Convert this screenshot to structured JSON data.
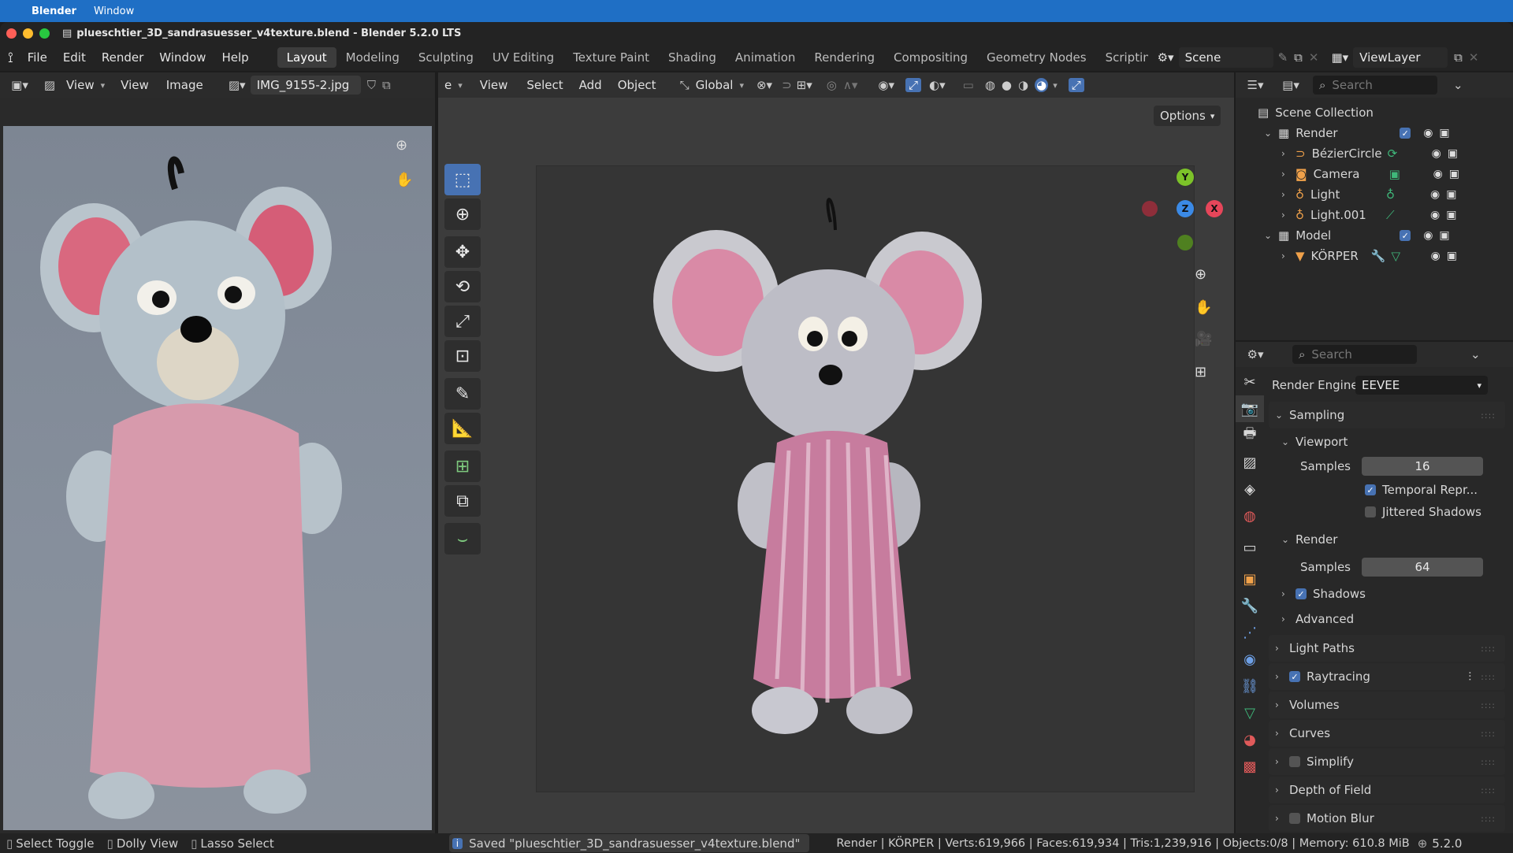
{
  "mac_menu": {
    "app": "Blender",
    "window": "Window"
  },
  "window_title": "plueschtier_3D_sandrasuesser_v4texture.blend - Blender 5.2.0 LTS",
  "menus": [
    "File",
    "Edit",
    "Render",
    "Window",
    "Help"
  ],
  "workspaces": [
    "Layout",
    "Modeling",
    "Sculpting",
    "UV Editing",
    "Texture Paint",
    "Shading",
    "Animation",
    "Rendering",
    "Compositing",
    "Geometry Nodes",
    "Scriptin"
  ],
  "scene_name": "Scene",
  "view_layer": "ViewLayer",
  "image_editor": {
    "view1": "View",
    "view2": "View",
    "image": "Image",
    "filename": "IMG_9155-2.jpg"
  },
  "viewport": {
    "mode": "e",
    "view": "View",
    "select": "Select",
    "add": "Add",
    "object": "Object",
    "orientation": "Global",
    "options": "Options",
    "gizmo": {
      "x": "X",
      "y": "Y",
      "z": "Z"
    }
  },
  "outliner": {
    "search_placeholder": "Search",
    "scene_collection": "Scene Collection",
    "items": [
      {
        "name": "Render"
      },
      {
        "name": "BézierCircle"
      },
      {
        "name": "Camera"
      },
      {
        "name": "Light"
      },
      {
        "name": "Light.001"
      },
      {
        "name": "Model"
      },
      {
        "name": "KÖRPER"
      }
    ]
  },
  "properties": {
    "search_placeholder": "Search",
    "render_engine_label": "Render Engine",
    "render_engine": "EEVEE",
    "sampling": "Sampling",
    "viewport": "Viewport",
    "samples_label": "Samples",
    "viewport_samples": "16",
    "temporal": "Temporal Repr...",
    "jittered": "Jittered Shadows",
    "render": "Render",
    "render_samples": "64",
    "shadows": "Shadows",
    "advanced": "Advanced",
    "light_paths": "Light Paths",
    "raytracing": "Raytracing",
    "volumes": "Volumes",
    "curves": "Curves",
    "simplify": "Simplify",
    "dof": "Depth of Field",
    "motion_blur": "Motion Blur"
  },
  "status": {
    "select_toggle": "Select Toggle",
    "dolly_view": "Dolly View",
    "lasso_select": "Lasso Select",
    "saved": "Saved \"plueschtier_3D_sandrasuesser_v4texture.blend\"",
    "stats": "Render | KÖRPER | Verts:619,966 | Faces:619,934 | Tris:1,239,916 | Objects:0/8 | Memory: 610.8 MiB",
    "version": "5.2.0"
  }
}
